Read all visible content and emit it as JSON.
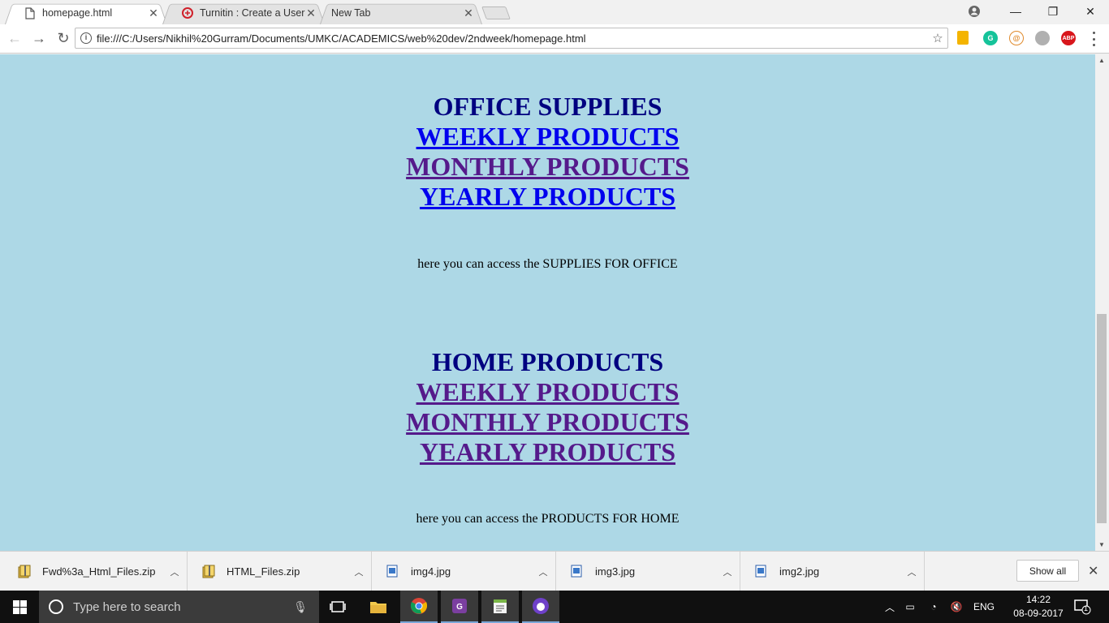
{
  "browser": {
    "tabs": [
      {
        "title": "homepage.html",
        "active": true,
        "icon": "document-icon"
      },
      {
        "title": "Turnitin : Create a User P",
        "active": false,
        "icon": "turnitin-icon"
      },
      {
        "title": "New Tab",
        "active": false,
        "icon": "none"
      }
    ],
    "url": "file:///C:/Users/Nikhil%20Gurram/Documents/UMKC/ACADEMICS/web%20dev/2ndweek/homepage.html",
    "extensions": [
      "bookmark-ext-icon",
      "grammarly-icon",
      "ext-orange-icon",
      "ext-cloud-icon",
      "adblock-plus-icon"
    ],
    "adblock_label": "ABP"
  },
  "page": {
    "background": "#add8e6",
    "sections": [
      {
        "heading": "OFFICE SUPPLIES",
        "links": [
          {
            "label": "WEEKLY PRODUCTS ",
            "visited": false
          },
          {
            "label": "MONTHLY PRODUCTS ",
            "visited": true
          },
          {
            "label": "YEARLY PRODUCTS ",
            "visited": false
          }
        ],
        "description": "here you can access the SUPPLIES FOR OFFICE"
      },
      {
        "heading": "HOME PRODUCTS",
        "links": [
          {
            "label": "WEEKLY PRODUCTS ",
            "visited": true
          },
          {
            "label": "MONTHLY PRODUCTS ",
            "visited": true
          },
          {
            "label": "YEARLY PRODUCTS ",
            "visited": true
          }
        ],
        "description": "here you can access the PRODUCTS FOR HOME"
      }
    ]
  },
  "downloads": {
    "items": [
      {
        "name": "Fwd%3a_Html_Files.zip",
        "type": "zip"
      },
      {
        "name": "HTML_Files.zip",
        "type": "zip"
      },
      {
        "name": "img4.jpg",
        "type": "image"
      },
      {
        "name": "img3.jpg",
        "type": "image"
      },
      {
        "name": "img2.jpg",
        "type": "image"
      }
    ],
    "show_all": "Show all"
  },
  "taskbar": {
    "search_placeholder": "Type here to search",
    "language": "ENG",
    "time": "14:22",
    "date": "08-09-2017",
    "notification_count": "1"
  },
  "colors": {
    "heading": "#000080",
    "link_unvisited": "#0000ee",
    "link_visited": "#551a8b"
  }
}
